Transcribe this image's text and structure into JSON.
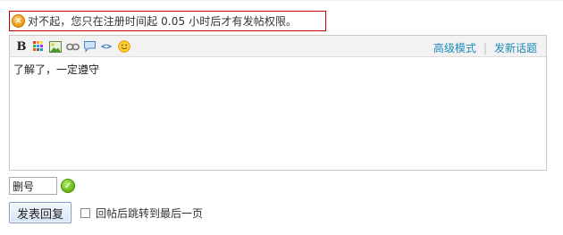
{
  "notice": {
    "icon": "warning-x-icon",
    "text": "对不起，您只在注册时间起 0.05 小时后才有发帖权限。",
    "border_color": "#cc0000"
  },
  "editor": {
    "toolbar": {
      "bold_label": "B",
      "code_label": "<>",
      "icons": [
        "bold-icon",
        "color-icon",
        "image-icon",
        "link-icon",
        "quote-icon",
        "code-icon",
        "smiley-icon"
      ]
    },
    "advanced_mode_label": "高级模式",
    "separator": "|",
    "new_topic_label": "发新话题",
    "content": "了解了，一定遵守"
  },
  "nickname": {
    "value": "删号",
    "status_icon": "check-icon"
  },
  "submit": {
    "button_label": "发表回复",
    "checkbox_label": "回帖后跳转到最后一页",
    "checkbox_checked": false
  },
  "colors": {
    "link": "#1d8bb8",
    "toolbar_bg": "#f2f2f2"
  }
}
